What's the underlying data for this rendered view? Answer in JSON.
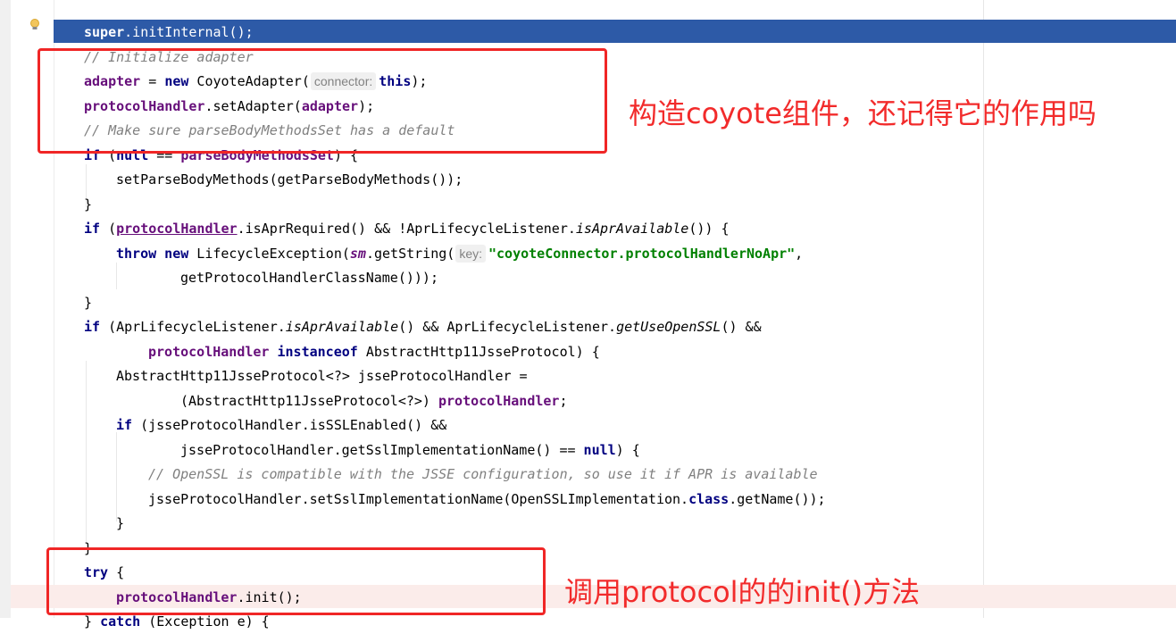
{
  "editor": {
    "lines": {
      "l1": {
        "kw": "super",
        "rest": ".initInternal();"
      },
      "l2": {
        "comment": "// Initialize adapter"
      },
      "l3": {
        "field": "adapter",
        "a": " = ",
        "kw": "new",
        "b": " CoyoteAdapter(",
        "hint": "connector:",
        "kw2": "this",
        "c": ");"
      },
      "l4": {
        "field": "protocolHandler",
        "a": ".setAdapter(",
        "field2": "adapter",
        "b": ");"
      },
      "l5": {
        "comment": "// Make sure parseBodyMethodsSet has a default"
      },
      "l6": {
        "kw": "if",
        "a": " (",
        "kw2": "null",
        "b": " == ",
        "field": "parseBodyMethodsSet",
        "c": ") {"
      },
      "l7": {
        "text": "setParseBodyMethods(getParseBodyMethods());"
      },
      "l8": {
        "text": "}"
      },
      "l9": {
        "kw": "if",
        "a": " (",
        "field": "protocolHandler",
        "b": ".isAprRequired() && !AprLifecycleListener.",
        "it": "isAprAvailable",
        "c": "()) {"
      },
      "l10": {
        "kw": "throw new",
        "a": " LifecycleException(",
        "field": "sm",
        "b": ".getString(",
        "hint": "key:",
        "str": "\"coyoteConnector.protocolHandlerNoApr\"",
        "c": ","
      },
      "l11": {
        "text": "getProtocolHandlerClassName()));"
      },
      "l12": {
        "text": "}"
      },
      "l13": {
        "kw": "if",
        "a": " (AprLifecycleListener.",
        "it": "isAprAvailable",
        "b": "() && AprLifecycleListener.",
        "it2": "getUseOpenSSL",
        "c": "() &&"
      },
      "l14": {
        "field": "protocolHandler",
        "kw": " instanceof",
        "a": " AbstractHttp11JsseProtocol) {"
      },
      "l15": {
        "text": "AbstractHttp11JsseProtocol<?> jsseProtocolHandler ="
      },
      "l16": {
        "a": "(AbstractHttp11JsseProtocol<?>) ",
        "field": "protocolHandler",
        "b": ";"
      },
      "l17": {
        "kw": "if",
        "a": " (jsseProtocolHandler.isSSLEnabled() &&"
      },
      "l18": {
        "a": "jsseProtocolHandler.getSslImplementationName() == ",
        "kw": "null",
        "b": ") {"
      },
      "l19": {
        "comment": "// OpenSSL is compatible with the JSSE configuration, so use it if APR is available"
      },
      "l20": {
        "a": "jsseProtocolHandler.setSslImplementationName(OpenSSLImplementation.",
        "kw": "class",
        "b": ".getName());"
      },
      "l21": {
        "text": "}"
      },
      "l22": {
        "text": "}"
      },
      "l23": {
        "kw": "try",
        "a": " {"
      },
      "l24": {
        "field": "protocolHandler",
        "a": ".init();"
      },
      "l25": {
        "a": "} ",
        "kw": "catch",
        "b": " (Exception e) {"
      }
    }
  },
  "annotations": {
    "note1": "构造coyote组件，还记得它的作用吗",
    "note2": "调用protocol的的init()方法"
  },
  "colors": {
    "selection_line": "#2d5aa7",
    "current_line": "#fbecea",
    "annotation_red": "#f02626",
    "keyword": "#000080",
    "field": "#660e7a",
    "comment": "#808080",
    "string": "#008000"
  }
}
